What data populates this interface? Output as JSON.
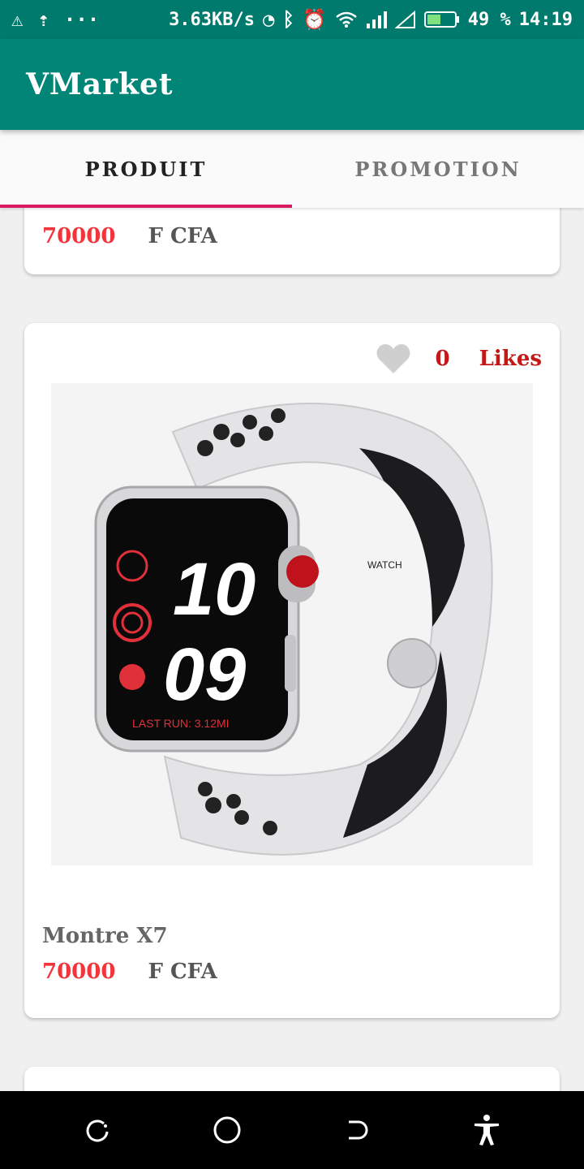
{
  "status_bar": {
    "left_icons": [
      "warning-triangle-icon",
      "upload-icon",
      "more-icon"
    ],
    "network_speed": "3.63KB/s",
    "battery_percent": "49 %",
    "time": "14:19"
  },
  "app_bar": {
    "title": "VMarket"
  },
  "tabs": [
    {
      "label": "PRODUIT",
      "selected": true
    },
    {
      "label": "PROMOTION",
      "selected": false
    }
  ],
  "cards": [
    {
      "price": "70000",
      "currency": "F CFA"
    },
    {
      "likes_count": "0",
      "likes_label": "Likes",
      "image_caption": "",
      "watch_hour": "10",
      "watch_minute": "09",
      "watch_caption": "LAST RUN: 3.12MI",
      "strap_brand": "WATCH",
      "name": "Montre X7",
      "price": "70000",
      "currency": "F CFA"
    }
  ],
  "colors": {
    "primary": "#008577",
    "primary_dark": "#007a6c",
    "accent": "#d81b60",
    "price": "#f2353b",
    "likes": "#c21818"
  }
}
